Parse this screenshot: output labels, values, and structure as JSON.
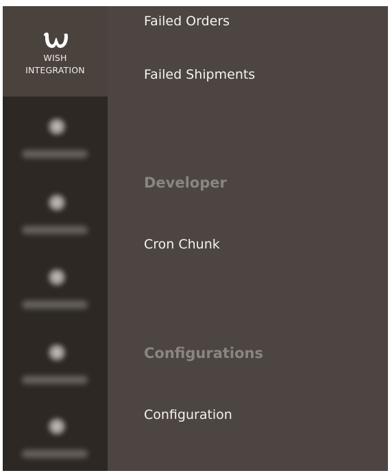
{
  "rail": {
    "active_item": {
      "icon": "wish-logo-icon",
      "label_line1": "WISH",
      "label_line2": "INTEGRATION"
    }
  },
  "submenu": {
    "sections": [
      {
        "heading": "",
        "links": [
          "Failed Orders",
          "Failed Shipments"
        ]
      },
      {
        "heading": "Developer",
        "links": [
          "Cron Chunk"
        ]
      },
      {
        "heading": "Configurations",
        "links": [
          "Configuration"
        ]
      }
    ]
  },
  "colors": {
    "submenu_bg": "#4c4542",
    "rail_bg": "#2d2824",
    "rail_active_bg": "#4a423d",
    "link_text": "#f6f2ee",
    "heading_text": "#8b8580"
  }
}
